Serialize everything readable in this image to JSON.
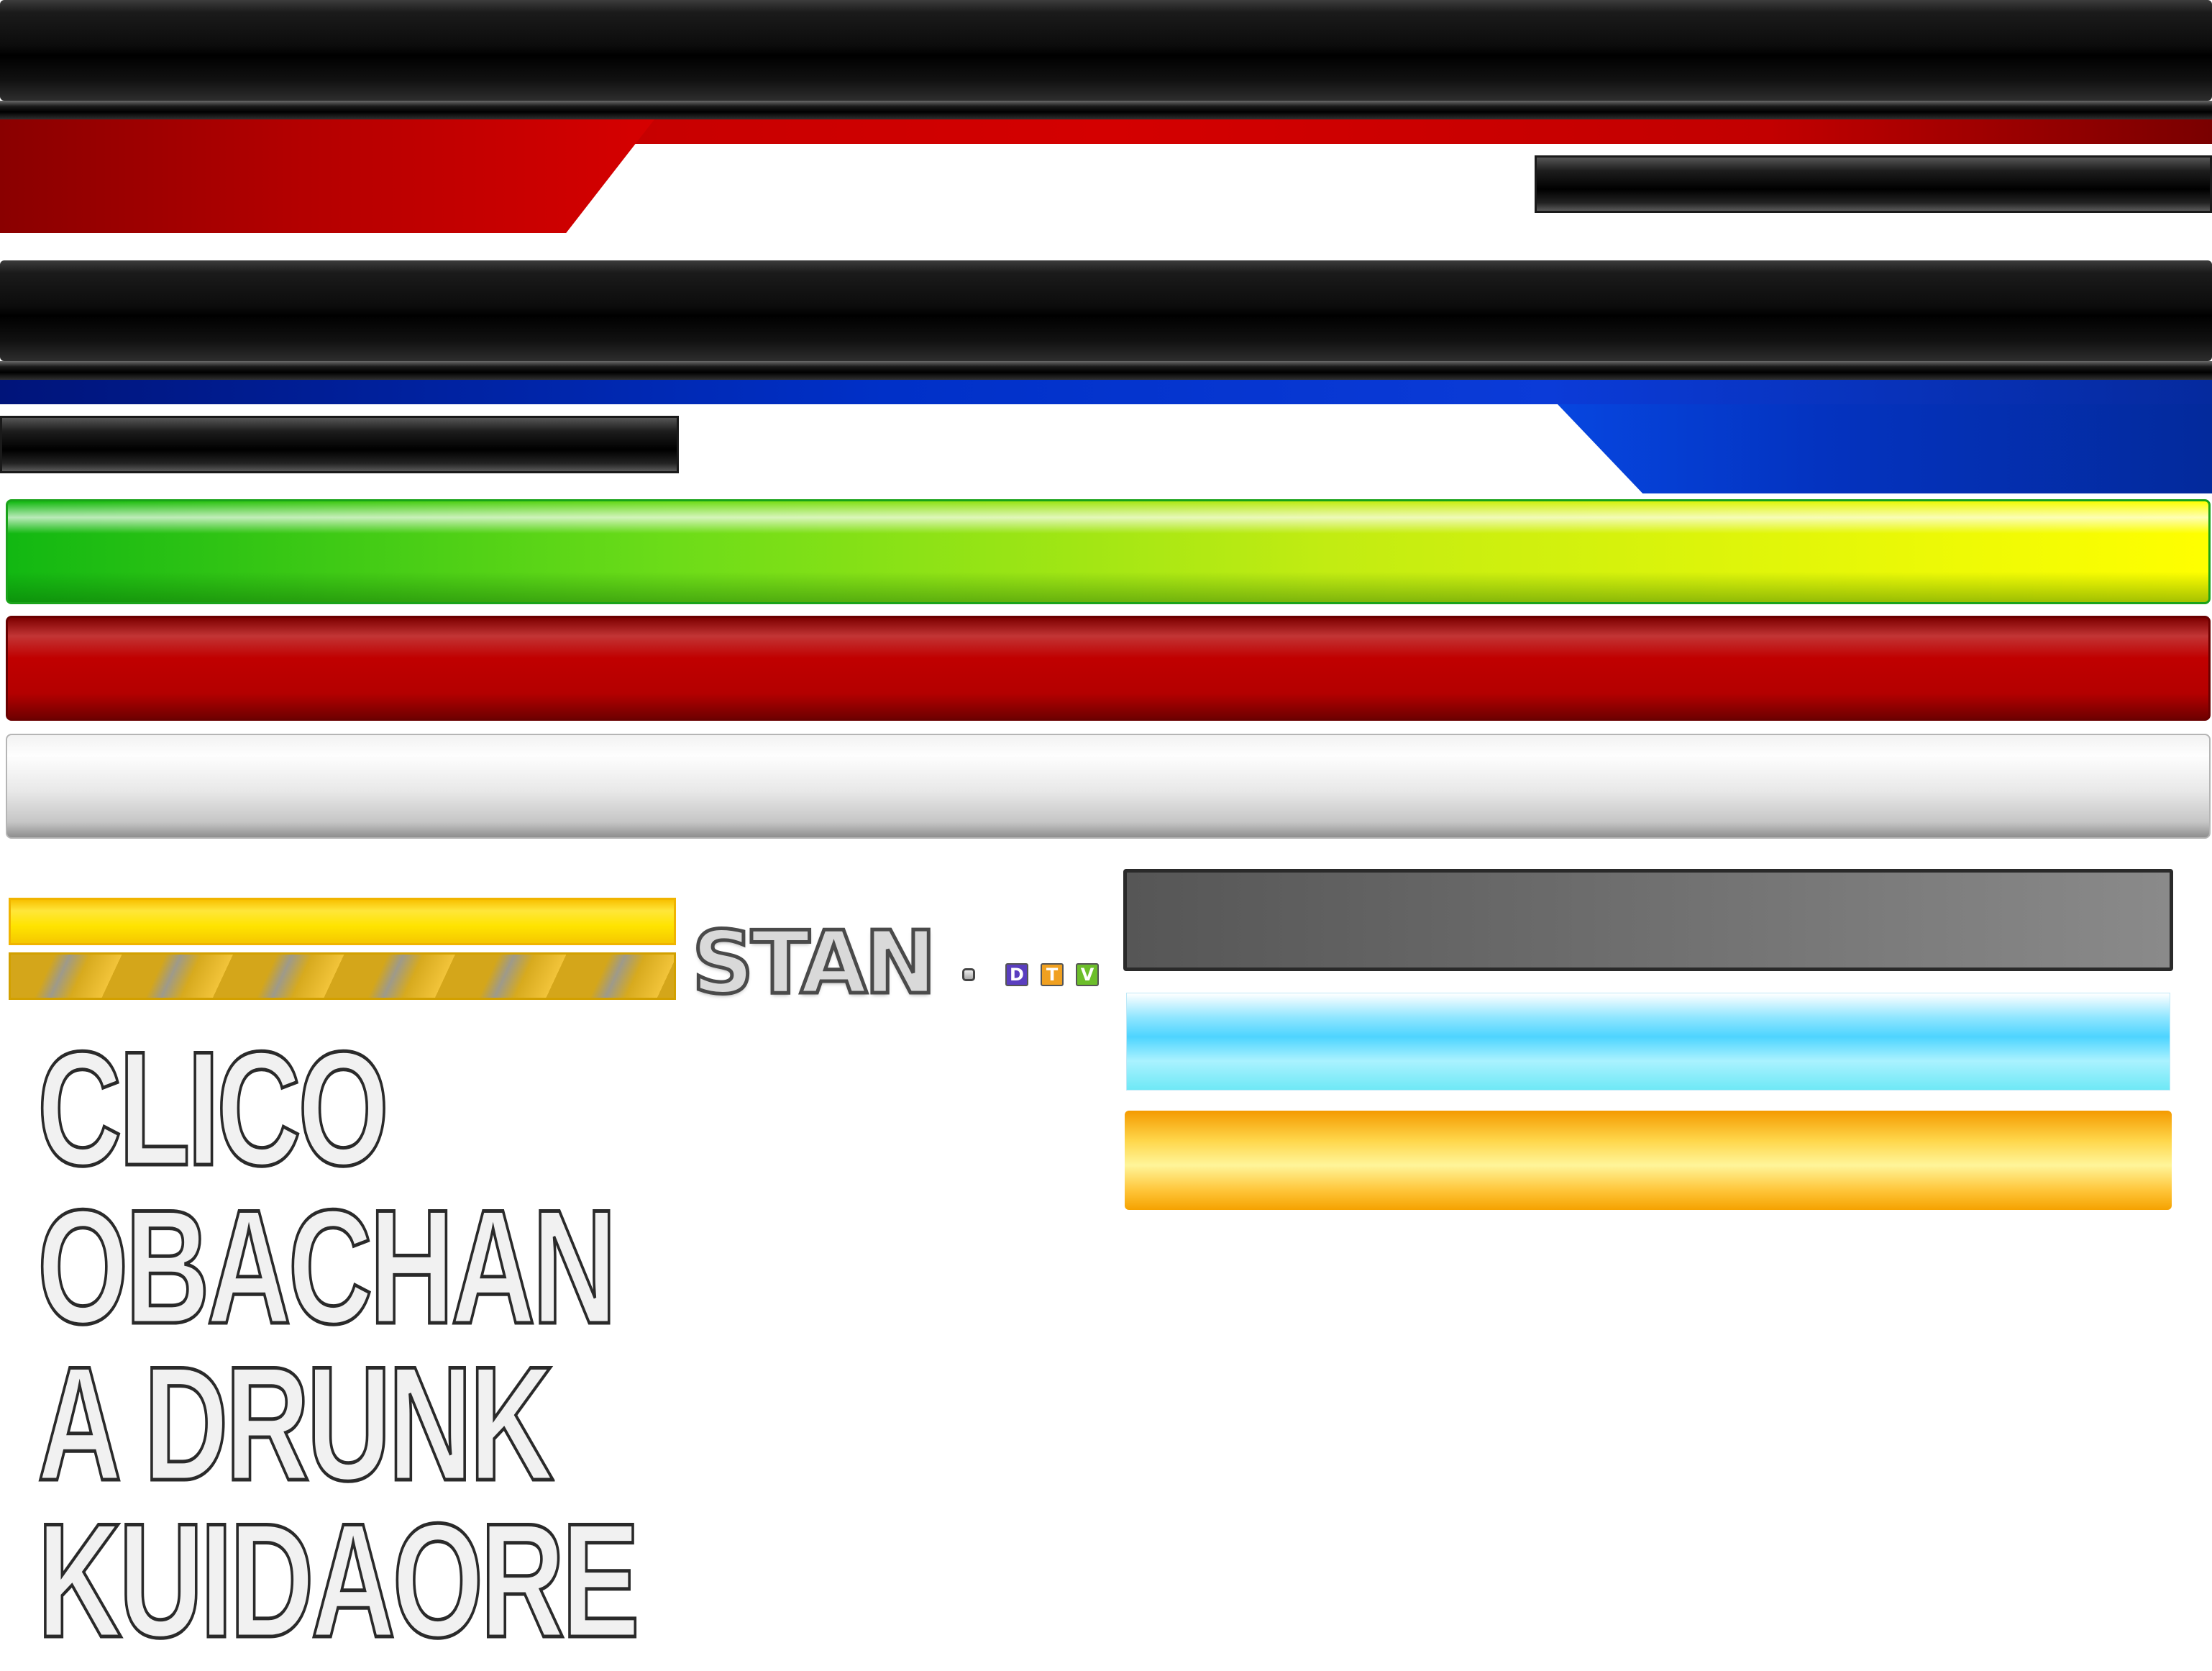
{
  "texts": {
    "stan": "STAN",
    "words": [
      "CLICO",
      "OBACHAN",
      "A DRUNK",
      "KUIDAORE"
    ]
  },
  "badges": [
    {
      "letter": "D",
      "color": "#5a3ebf"
    },
    {
      "letter": "T",
      "color": "#f0a020"
    },
    {
      "letter": "V",
      "color": "#6cbe2a"
    }
  ],
  "colors": {
    "red": "#c80000",
    "blue": "#0030c8",
    "green": "#6cdc18",
    "yellow": "#ffe400",
    "gray": "#6a6a6a",
    "cyan": "#4dd4ff",
    "orange": "#ffc63a"
  }
}
